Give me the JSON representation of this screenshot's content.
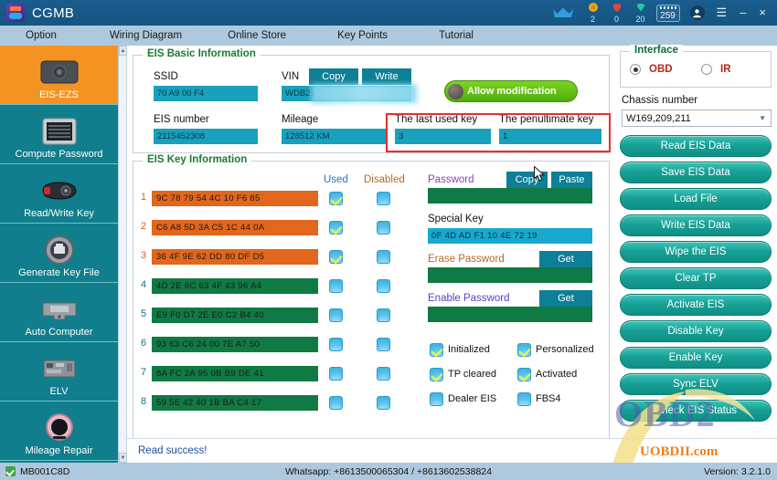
{
  "titlebar": {
    "app_name": "CGMB",
    "logo_icon": "cgmb-logo-icon",
    "crown_icon": "crown-icon",
    "coin_icon": "coin-icon",
    "coin_value": "2",
    "heart_icon": "heart-icon",
    "heart_value": "0",
    "diamond_icon": "diamond-icon",
    "diamond_value": "20",
    "battery_badge": "259",
    "user_icon": "user-icon",
    "menu_icon": "hamburger-menu-icon",
    "minimize_label": "–",
    "close_label": "×"
  },
  "menubar": {
    "items": [
      {
        "label": "Option"
      },
      {
        "label": "Wiring Diagram"
      },
      {
        "label": "Online Store"
      },
      {
        "label": "Key Points"
      },
      {
        "label": "Tutorial"
      }
    ]
  },
  "sidebar": {
    "items": [
      {
        "label": "EIS-EZS",
        "icon": "eis-module-icon",
        "active": true
      },
      {
        "label": "Compute Password",
        "icon": "keypad-icon",
        "active": false
      },
      {
        "label": "Read/Write Key",
        "icon": "car-key-icon",
        "active": false
      },
      {
        "label": "Generate Key File",
        "icon": "key-file-icon",
        "active": false
      },
      {
        "label": "Auto Computer",
        "icon": "ecu-icon",
        "active": false
      },
      {
        "label": "ELV",
        "icon": "elv-board-icon",
        "active": false
      },
      {
        "label": "Mileage Repair",
        "icon": "odometer-icon",
        "active": false
      }
    ],
    "scroll_up": "▲",
    "scroll_down": "▼"
  },
  "basic_info": {
    "legend": "EIS Basic Information",
    "ssid_label": "SSID",
    "ssid_value": "70  A9  00  F4",
    "vin_label": "VIN",
    "vin_value": "WDB21",
    "copy_label": "Copy",
    "write_label": "Write",
    "allow_modification_label": "Allow modification",
    "eis_number_label": "EIS number",
    "eis_number_value": "2115452308",
    "mileage_label": "Mileage",
    "mileage_value": "128512   KM",
    "last_used_key_label": "The last used key",
    "last_used_key_value": "3",
    "penultimate_key_label": "The penultimate key",
    "penultimate_key_value": "1"
  },
  "key_info": {
    "legend": "EIS Key Information",
    "col_used": "Used",
    "col_disabled": "Disabled",
    "rows": [
      {
        "num": "1",
        "value": "9C  78  79  54  4C  10  F6  85",
        "state": "used",
        "used": true,
        "disabled": false
      },
      {
        "num": "2",
        "value": "C6  A8  5D  3A  C5  1C  44  0A",
        "state": "used",
        "used": true,
        "disabled": false
      },
      {
        "num": "3",
        "value": "36  4F  9E  62  DD  80  DF  D5",
        "state": "used",
        "used": true,
        "disabled": false
      },
      {
        "num": "4",
        "value": "4D  2E  6C  63  4F  43  96  A4",
        "state": "free",
        "used": false,
        "disabled": false
      },
      {
        "num": "5",
        "value": "E9  F0  D7  2E  E0  C2  B4  40",
        "state": "free",
        "used": false,
        "disabled": false
      },
      {
        "num": "6",
        "value": "93  63  C6  24  00  7E  A7  50",
        "state": "free",
        "used": false,
        "disabled": false
      },
      {
        "num": "7",
        "value": "8A  FC  2A  95  0B  B9  DE  41",
        "state": "free",
        "used": false,
        "disabled": false
      },
      {
        "num": "8",
        "value": "59  5E  42  40  1B  BA  C4  17",
        "state": "free",
        "used": false,
        "disabled": false
      }
    ],
    "password_label": "Password",
    "password_value": "",
    "copy_label": "Copy",
    "paste_label": "Paste",
    "special_key_label": "Special Key",
    "special_key_value": "0F  4D  AD  F1  10  4E  72  19",
    "erase_password_label": "Erase Password",
    "erase_password_value": "",
    "erase_get_label": "Get",
    "enable_password_label": "Enable Password",
    "enable_password_value": "",
    "enable_get_label": "Get",
    "flags": [
      {
        "label": "Initialized",
        "checked": true
      },
      {
        "label": "Personalized",
        "checked": true
      },
      {
        "label": "TP cleared",
        "checked": true
      },
      {
        "label": "Activated",
        "checked": true
      },
      {
        "label": "Dealer EIS",
        "checked": false
      },
      {
        "label": "FBS4",
        "checked": false
      }
    ]
  },
  "interface": {
    "legend": "Interface",
    "options": [
      {
        "label": "OBD",
        "selected": true
      },
      {
        "label": "IR",
        "selected": false
      }
    ],
    "chassis_label": "Chassis number",
    "chassis_value": "W169,209,211",
    "chevron_icon": "chevron-down-icon"
  },
  "actions": {
    "buttons": [
      {
        "label": "Read EIS Data"
      },
      {
        "label": "Save EIS Data"
      },
      {
        "label": "Load File"
      },
      {
        "label": "Write EIS Data"
      },
      {
        "label": "Wipe the EIS"
      },
      {
        "label": "Clear TP"
      },
      {
        "label": "Activate EIS"
      },
      {
        "label": "Disable Key"
      },
      {
        "label": "Enable Key"
      },
      {
        "label": "Sync ELV"
      },
      {
        "label": "Check EIS Status"
      }
    ]
  },
  "message": {
    "text": "Read  success!"
  },
  "statusbar": {
    "device": "MB001C8D",
    "whatsapp": "Whatsapp: +8613500065304 / +8613602538824",
    "version": "Version: 3.2.1.0"
  },
  "watermark": {
    "obd2": "OBD2",
    "site": "UOBDII.com"
  },
  "colors": {
    "titlebar": "#15557f",
    "menubar": "#aec9dd",
    "sidebar": "#107e8c",
    "sidebar_active": "#f59322",
    "field_cyan": "#18a0bd",
    "key_used": "#e2661c",
    "key_free": "#0f7a43",
    "action_button": "#17a196",
    "allow_modification": "#4fae0e",
    "highlight_box": "#ef2b2b"
  }
}
